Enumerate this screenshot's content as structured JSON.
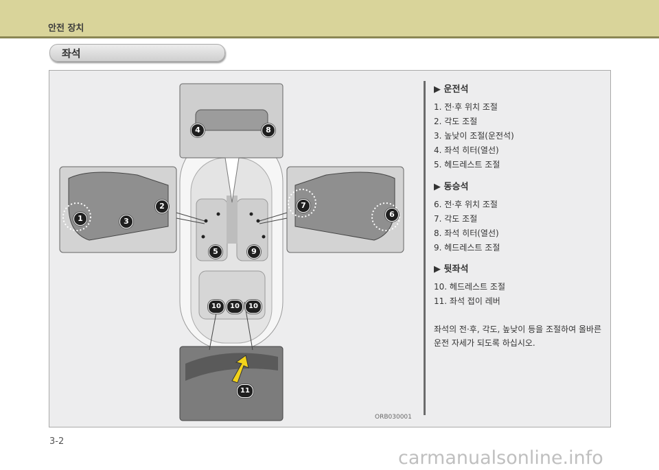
{
  "header": {
    "title": "안전 장치"
  },
  "section": {
    "title": "좌석"
  },
  "figure": {
    "code": "ORB030001",
    "badges": [
      "1",
      "2",
      "3",
      "4",
      "5",
      "6",
      "7",
      "8",
      "9",
      "10",
      "11"
    ]
  },
  "groups": [
    {
      "heading": "▶ 운전석",
      "items": [
        "1.  전·후 위치 조절",
        "2.  각도 조절",
        "3.  높낮이 조절(운전석)",
        "4.  좌석 히터(열선)",
        "5.  헤드레스트 조절"
      ]
    },
    {
      "heading": "▶ 동승석",
      "items": [
        "6.  전·후 위치 조절",
        "7.  각도 조절",
        "8.  좌석 히터(열선)",
        "9.  헤드레스트 조절"
      ]
    },
    {
      "heading": "▶ 뒷좌석",
      "items": [
        "10.  헤드레스트 조절",
        "11.  좌석 접이 레버"
      ]
    }
  ],
  "note": "좌석의 전·후, 각도, 높낮이 등을 조절하여 올바른 운전 자세가 되도록 하십시오.",
  "page_number": "3-2",
  "watermark": "carmanualsonline.info"
}
